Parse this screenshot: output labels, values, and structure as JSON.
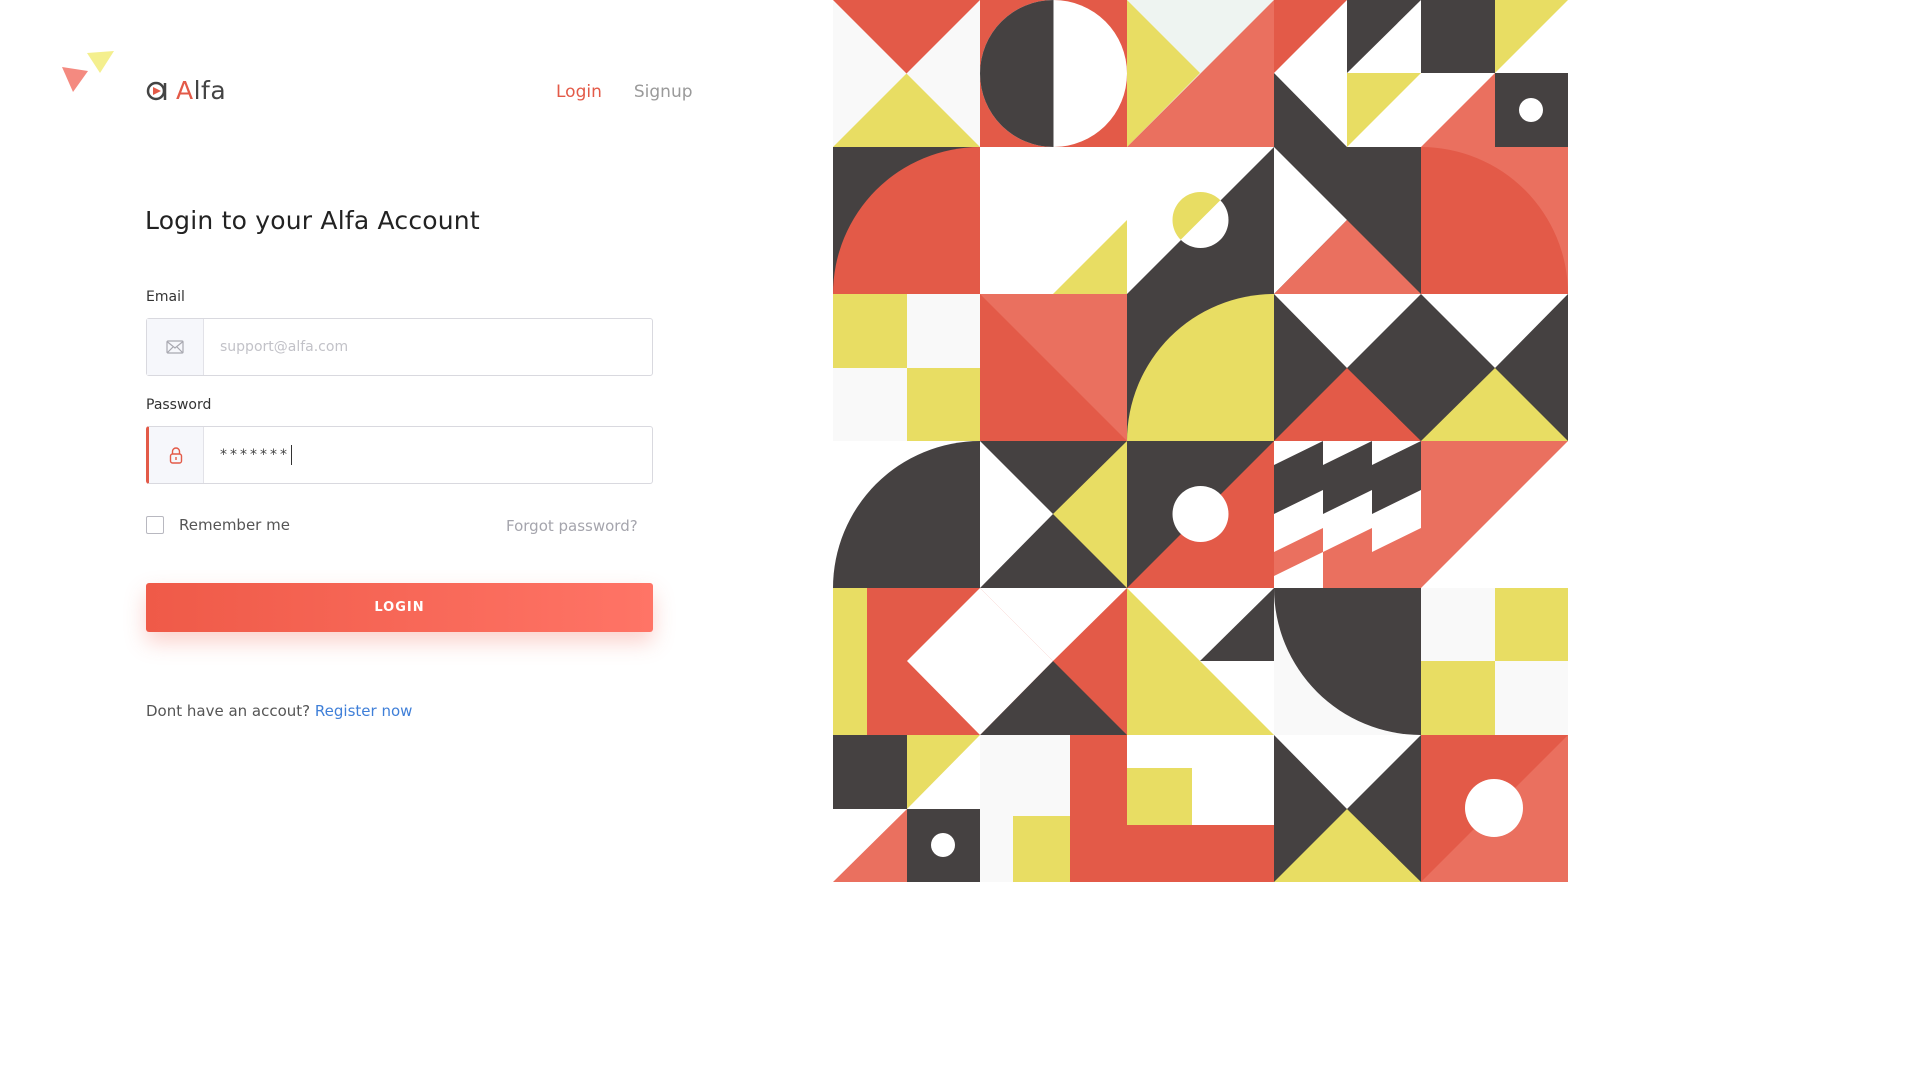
{
  "brand": {
    "name_first": "A",
    "name_rest": "lfa"
  },
  "nav": {
    "login": "Login",
    "signup": "Signup"
  },
  "title": "Login to your Alfa Account",
  "email": {
    "label": "Email",
    "placeholder": "support@alfa.com"
  },
  "password": {
    "label": "Password",
    "value": "*******"
  },
  "remember_label": "Remember me",
  "forgot_label": "Forgot password?",
  "login_button": "LOGIN",
  "register": {
    "prompt": "Dont have an accout?",
    "link": "Register now"
  },
  "colors": {
    "red": "#e35a48",
    "coral": "#ea705f",
    "yellow": "#e8dd63",
    "charcoal": "#454141",
    "offwhite": "#f9f9f9",
    "link_blue": "#3f7fd8"
  },
  "icons": [
    "logo-mark-icon",
    "envelope-icon",
    "lock-icon",
    "decorative-triangles-icon"
  ]
}
